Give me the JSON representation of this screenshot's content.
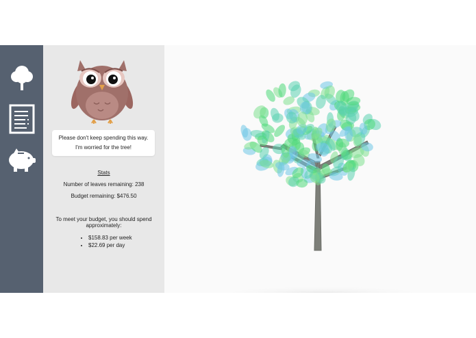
{
  "nav": {
    "items": [
      {
        "name": "tree",
        "icon": "tree-icon"
      },
      {
        "name": "list",
        "icon": "list-document-icon"
      },
      {
        "name": "budget",
        "icon": "piggy-bank-icon"
      }
    ]
  },
  "owl": {
    "message_line1": "Please don't keep spending this way.",
    "message_line2": "I'm worried for the tree!"
  },
  "stats": {
    "title": "Stats",
    "leaves": "Number of leaves remaining: 238",
    "budget": "Budget remaining: $476.50"
  },
  "advice": {
    "text": "To meet your budget, you should spend approximately:",
    "per_week": "$158.83 per week",
    "per_day": "$22.69 per day"
  },
  "colors": {
    "sidebar": "#566170",
    "panel": "#e8e8e8",
    "leaf_green": "#4fd87a",
    "leaf_blue": "#6fc7e6",
    "trunk": "#7d7f79"
  }
}
